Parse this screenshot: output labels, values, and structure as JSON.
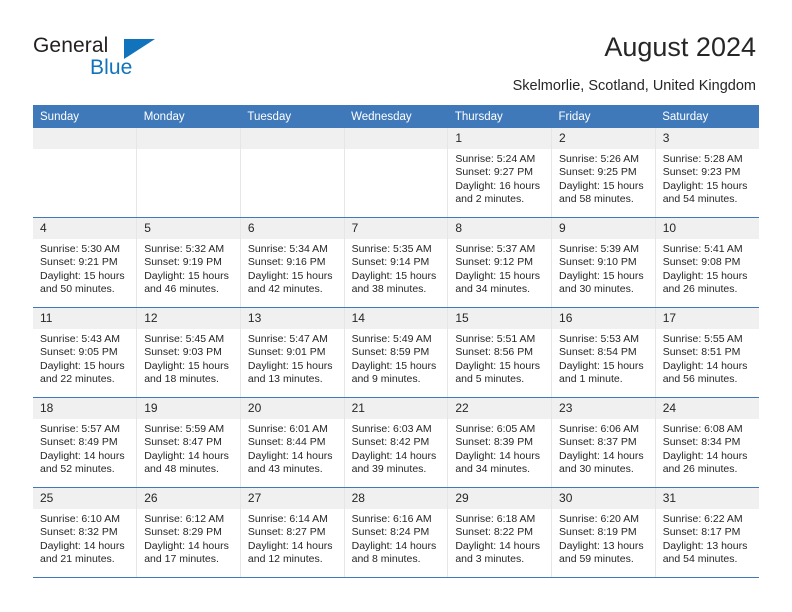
{
  "brand": {
    "name_top": "General",
    "name_bottom": "Blue",
    "triangle_icon": "blue-triangle-logo-mark",
    "color_top": "#231f20",
    "color_bottom": "#1273bd"
  },
  "header": {
    "title": "August 2024",
    "subtitle": "Skelmorlie, Scotland, United Kingdom"
  },
  "theme": {
    "header_bg": "#3f79ba",
    "header_text": "#ffffff",
    "daynum_bg": "#f0f0f0",
    "row_rule": "#3f79ba",
    "cell_divider": "#e6e6e6",
    "body_text": "#262626"
  },
  "weekday_headers": [
    "Sunday",
    "Monday",
    "Tuesday",
    "Wednesday",
    "Thursday",
    "Friday",
    "Saturday"
  ],
  "weeks": [
    [
      {
        "day": "",
        "l1": "",
        "l2": "",
        "l3": "",
        "l4": ""
      },
      {
        "day": "",
        "l1": "",
        "l2": "",
        "l3": "",
        "l4": ""
      },
      {
        "day": "",
        "l1": "",
        "l2": "",
        "l3": "",
        "l4": ""
      },
      {
        "day": "",
        "l1": "",
        "l2": "",
        "l3": "",
        "l4": ""
      },
      {
        "day": "1",
        "l1": "Sunrise: 5:24 AM",
        "l2": "Sunset: 9:27 PM",
        "l3": "Daylight: 16 hours",
        "l4": "and 2 minutes."
      },
      {
        "day": "2",
        "l1": "Sunrise: 5:26 AM",
        "l2": "Sunset: 9:25 PM",
        "l3": "Daylight: 15 hours",
        "l4": "and 58 minutes."
      },
      {
        "day": "3",
        "l1": "Sunrise: 5:28 AM",
        "l2": "Sunset: 9:23 PM",
        "l3": "Daylight: 15 hours",
        "l4": "and 54 minutes."
      }
    ],
    [
      {
        "day": "4",
        "l1": "Sunrise: 5:30 AM",
        "l2": "Sunset: 9:21 PM",
        "l3": "Daylight: 15 hours",
        "l4": "and 50 minutes."
      },
      {
        "day": "5",
        "l1": "Sunrise: 5:32 AM",
        "l2": "Sunset: 9:19 PM",
        "l3": "Daylight: 15 hours",
        "l4": "and 46 minutes."
      },
      {
        "day": "6",
        "l1": "Sunrise: 5:34 AM",
        "l2": "Sunset: 9:16 PM",
        "l3": "Daylight: 15 hours",
        "l4": "and 42 minutes."
      },
      {
        "day": "7",
        "l1": "Sunrise: 5:35 AM",
        "l2": "Sunset: 9:14 PM",
        "l3": "Daylight: 15 hours",
        "l4": "and 38 minutes."
      },
      {
        "day": "8",
        "l1": "Sunrise: 5:37 AM",
        "l2": "Sunset: 9:12 PM",
        "l3": "Daylight: 15 hours",
        "l4": "and 34 minutes."
      },
      {
        "day": "9",
        "l1": "Sunrise: 5:39 AM",
        "l2": "Sunset: 9:10 PM",
        "l3": "Daylight: 15 hours",
        "l4": "and 30 minutes."
      },
      {
        "day": "10",
        "l1": "Sunrise: 5:41 AM",
        "l2": "Sunset: 9:08 PM",
        "l3": "Daylight: 15 hours",
        "l4": "and 26 minutes."
      }
    ],
    [
      {
        "day": "11",
        "l1": "Sunrise: 5:43 AM",
        "l2": "Sunset: 9:05 PM",
        "l3": "Daylight: 15 hours",
        "l4": "and 22 minutes."
      },
      {
        "day": "12",
        "l1": "Sunrise: 5:45 AM",
        "l2": "Sunset: 9:03 PM",
        "l3": "Daylight: 15 hours",
        "l4": "and 18 minutes."
      },
      {
        "day": "13",
        "l1": "Sunrise: 5:47 AM",
        "l2": "Sunset: 9:01 PM",
        "l3": "Daylight: 15 hours",
        "l4": "and 13 minutes."
      },
      {
        "day": "14",
        "l1": "Sunrise: 5:49 AM",
        "l2": "Sunset: 8:59 PM",
        "l3": "Daylight: 15 hours",
        "l4": "and 9 minutes."
      },
      {
        "day": "15",
        "l1": "Sunrise: 5:51 AM",
        "l2": "Sunset: 8:56 PM",
        "l3": "Daylight: 15 hours",
        "l4": "and 5 minutes."
      },
      {
        "day": "16",
        "l1": "Sunrise: 5:53 AM",
        "l2": "Sunset: 8:54 PM",
        "l3": "Daylight: 15 hours",
        "l4": "and 1 minute."
      },
      {
        "day": "17",
        "l1": "Sunrise: 5:55 AM",
        "l2": "Sunset: 8:51 PM",
        "l3": "Daylight: 14 hours",
        "l4": "and 56 minutes."
      }
    ],
    [
      {
        "day": "18",
        "l1": "Sunrise: 5:57 AM",
        "l2": "Sunset: 8:49 PM",
        "l3": "Daylight: 14 hours",
        "l4": "and 52 minutes."
      },
      {
        "day": "19",
        "l1": "Sunrise: 5:59 AM",
        "l2": "Sunset: 8:47 PM",
        "l3": "Daylight: 14 hours",
        "l4": "and 48 minutes."
      },
      {
        "day": "20",
        "l1": "Sunrise: 6:01 AM",
        "l2": "Sunset: 8:44 PM",
        "l3": "Daylight: 14 hours",
        "l4": "and 43 minutes."
      },
      {
        "day": "21",
        "l1": "Sunrise: 6:03 AM",
        "l2": "Sunset: 8:42 PM",
        "l3": "Daylight: 14 hours",
        "l4": "and 39 minutes."
      },
      {
        "day": "22",
        "l1": "Sunrise: 6:05 AM",
        "l2": "Sunset: 8:39 PM",
        "l3": "Daylight: 14 hours",
        "l4": "and 34 minutes."
      },
      {
        "day": "23",
        "l1": "Sunrise: 6:06 AM",
        "l2": "Sunset: 8:37 PM",
        "l3": "Daylight: 14 hours",
        "l4": "and 30 minutes."
      },
      {
        "day": "24",
        "l1": "Sunrise: 6:08 AM",
        "l2": "Sunset: 8:34 PM",
        "l3": "Daylight: 14 hours",
        "l4": "and 26 minutes."
      }
    ],
    [
      {
        "day": "25",
        "l1": "Sunrise: 6:10 AM",
        "l2": "Sunset: 8:32 PM",
        "l3": "Daylight: 14 hours",
        "l4": "and 21 minutes."
      },
      {
        "day": "26",
        "l1": "Sunrise: 6:12 AM",
        "l2": "Sunset: 8:29 PM",
        "l3": "Daylight: 14 hours",
        "l4": "and 17 minutes."
      },
      {
        "day": "27",
        "l1": "Sunrise: 6:14 AM",
        "l2": "Sunset: 8:27 PM",
        "l3": "Daylight: 14 hours",
        "l4": "and 12 minutes."
      },
      {
        "day": "28",
        "l1": "Sunrise: 6:16 AM",
        "l2": "Sunset: 8:24 PM",
        "l3": "Daylight: 14 hours",
        "l4": "and 8 minutes."
      },
      {
        "day": "29",
        "l1": "Sunrise: 6:18 AM",
        "l2": "Sunset: 8:22 PM",
        "l3": "Daylight: 14 hours",
        "l4": "and 3 minutes."
      },
      {
        "day": "30",
        "l1": "Sunrise: 6:20 AM",
        "l2": "Sunset: 8:19 PM",
        "l3": "Daylight: 13 hours",
        "l4": "and 59 minutes."
      },
      {
        "day": "31",
        "l1": "Sunrise: 6:22 AM",
        "l2": "Sunset: 8:17 PM",
        "l3": "Daylight: 13 hours",
        "l4": "and 54 minutes."
      }
    ]
  ]
}
